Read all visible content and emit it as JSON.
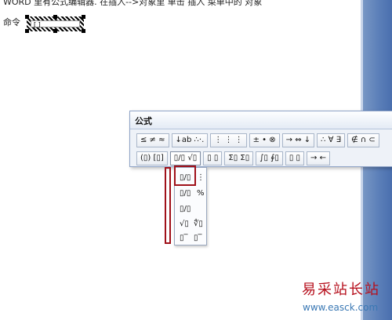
{
  "document": {
    "instruction_line": "WORD 里有公式编辑器. 在插入-->对象里 单击 插入 菜单中的 对象",
    "command_label": "命令",
    "cursor_mark": "[ ]"
  },
  "equation_editor": {
    "title": "公式",
    "row1": [
      "≤ ≠ ≈",
      "↓ab ∴·.",
      "⋮ ⋮ ⋮",
      "± • ⊗",
      "→ ⇔ ↓",
      "∴ ∀ ∃",
      "∉ ∩ ⊂"
    ],
    "row2": [
      "(▯) [▯]",
      "▯/▯ √▯",
      "▯ ▯",
      "Σ▯ Σ▯",
      "∫▯ ∮▯",
      "▯ ▯",
      "→ ←"
    ],
    "fraction_menu": {
      "items": [
        {
          "left": "▯/▯",
          "right": "⋮"
        },
        {
          "left": "▯/▯",
          "right": "%"
        },
        {
          "left": "▯/▯",
          "right": ""
        },
        {
          "left": "√▯",
          "right": "∜▯"
        },
        {
          "left": "▯‾",
          "right": "▯‾"
        }
      ]
    }
  },
  "watermark": {
    "title": "易采站长站",
    "url": "www.easck.com"
  },
  "colors": {
    "highlight": "#a0111a",
    "taskbar_blue": "#5a7eb8",
    "watermark_red": "#b60f1c",
    "watermark_blue": "#3a78b4"
  }
}
